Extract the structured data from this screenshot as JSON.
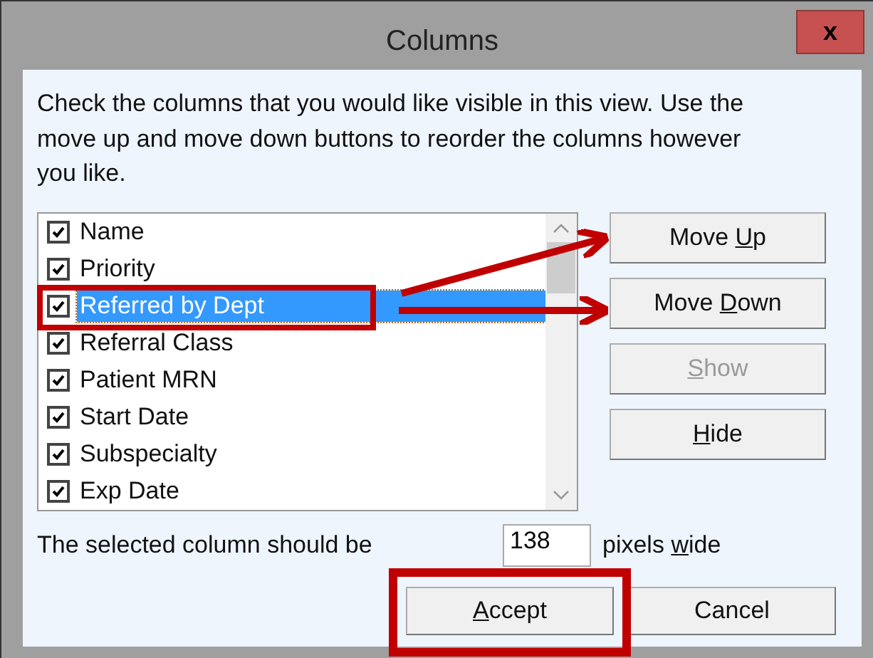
{
  "window": {
    "title": "Columns",
    "close": "x"
  },
  "instructions": "Check the columns that you would like visible in this view. Use the move up and move down buttons to reorder the columns however you like.",
  "columns": [
    {
      "name": "Name",
      "checked": true,
      "selected": false
    },
    {
      "name": "Priority",
      "checked": true,
      "selected": false
    },
    {
      "name": "Referred by Dept",
      "checked": true,
      "selected": true
    },
    {
      "name": "Referral Class",
      "checked": true,
      "selected": false
    },
    {
      "name": "Patient MRN",
      "checked": true,
      "selected": false
    },
    {
      "name": "Start Date",
      "checked": true,
      "selected": false
    },
    {
      "name": "Subspecialty",
      "checked": true,
      "selected": false
    },
    {
      "name": "Exp Date",
      "checked": true,
      "selected": false
    }
  ],
  "side_buttons": [
    {
      "label": {
        "before": "Move ",
        "key": "U",
        "after": "p"
      },
      "disabled": false
    },
    {
      "label": {
        "before": "Move ",
        "key": "D",
        "after": "own"
      },
      "disabled": false
    },
    {
      "label": {
        "key": "S",
        "after": "how"
      },
      "disabled": true
    },
    {
      "label": {
        "key": "H",
        "after": "ide"
      },
      "disabled": false
    }
  ],
  "width_row": {
    "label": "The selected column should be",
    "value": "138",
    "unit": {
      "before": "pixels ",
      "key": "w",
      "after": "ide"
    }
  },
  "footer_buttons": [
    {
      "label": {
        "key": "A",
        "after": "ccept"
      },
      "disabled": false
    },
    {
      "label": {
        "before": "Cancel"
      },
      "disabled": false
    }
  ]
}
